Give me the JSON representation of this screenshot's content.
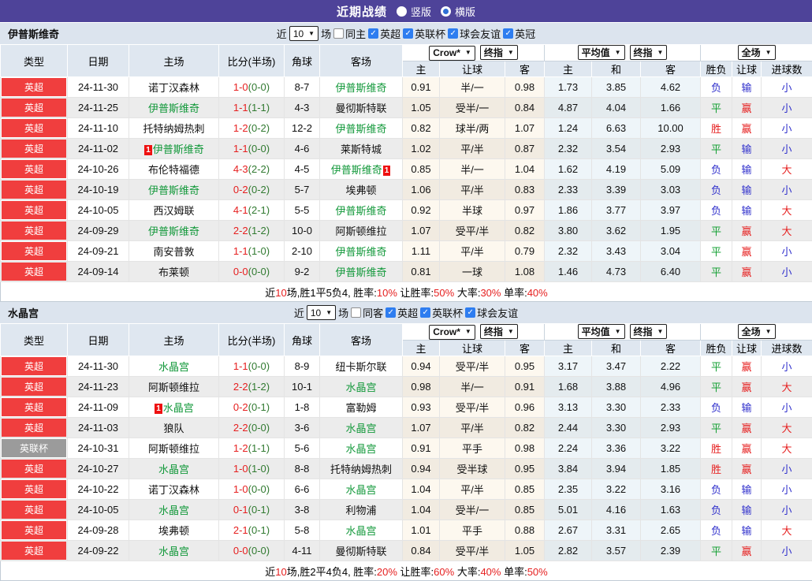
{
  "header": {
    "title": "近期战绩",
    "vertical_label": "竖版",
    "vertical_checked": false,
    "horizontal_label": "横版",
    "horizontal_checked": true
  },
  "table_header": {
    "main": [
      "类型",
      "日期",
      "主场",
      "比分(半场)",
      "角球",
      "客场"
    ],
    "sub": [
      "主",
      "让球",
      "客",
      "主",
      "和",
      "客",
      "胜负",
      "让球",
      "进球数"
    ],
    "selects": {
      "odds_source": "Crow*",
      "odds_final": "终指",
      "avg_source": "平均值",
      "avg_final": "终指",
      "full_match": "全场"
    }
  },
  "colors": {
    "topbar_bg": "#4e4399",
    "section_header_bg": "#dce4ee",
    "table_header_bg": "#dfe7f0",
    "badge_red": "#f03e3e",
    "badge_gray": "#9b9b9b",
    "team_green": "#12983a",
    "score_red": "#e62020",
    "half_score_green": "#317a31",
    "win_red": "#e62020",
    "draw_green": "#16a034",
    "lose_blue": "#3030cc",
    "checkbox_blue": "#2e7df0",
    "radio_blue": "#2f6fd6",
    "card_red": "#ee1111",
    "crow_tint": "#fdf8ef",
    "crow_tint_dark": "#f1ebe1",
    "avg_tint": "#eef5f9",
    "avg_tint_dark": "#e4ebee",
    "stripe_gray": "#ececec",
    "summary_red": "#e62020"
  },
  "sections": [
    {
      "team": "伊普斯维奇",
      "filters": {
        "near_label": "近",
        "count": "10",
        "matches_label": "场",
        "same_side_label": "同主",
        "same_side_checked": false,
        "leagues": [
          "英超",
          "英联杯",
          "球会友谊",
          "英冠"
        ]
      },
      "rows": [
        {
          "type": "英超",
          "type_color": "#f03e3e",
          "date": "24-11-30",
          "home": "诺丁汉森林",
          "home_focus": false,
          "home_card": "",
          "score": "1-0",
          "half": "(0-0)",
          "corner": "8-7",
          "away": "伊普斯维奇",
          "away_focus": true,
          "away_card": "",
          "crow": [
            "0.91",
            "半/一",
            "0.98"
          ],
          "avg": [
            "1.73",
            "3.85",
            "4.62"
          ],
          "result": [
            "负",
            "输",
            "小"
          ]
        },
        {
          "type": "英超",
          "type_color": "#f03e3e",
          "date": "24-11-25",
          "home": "伊普斯维奇",
          "home_focus": true,
          "home_card": "",
          "score": "1-1",
          "half": "(1-1)",
          "corner": "4-3",
          "away": "曼彻斯特联",
          "away_focus": false,
          "away_card": "",
          "crow": [
            "1.05",
            "受半/一",
            "0.84"
          ],
          "avg": [
            "4.87",
            "4.04",
            "1.66"
          ],
          "result": [
            "平",
            "赢",
            "小"
          ]
        },
        {
          "type": "英超",
          "type_color": "#f03e3e",
          "date": "24-11-10",
          "home": "托特纳姆热刺",
          "home_focus": false,
          "home_card": "",
          "score": "1-2",
          "half": "(0-2)",
          "corner": "12-2",
          "away": "伊普斯维奇",
          "away_focus": true,
          "away_card": "",
          "crow": [
            "0.82",
            "球半/两",
            "1.07"
          ],
          "avg": [
            "1.24",
            "6.63",
            "10.00"
          ],
          "result": [
            "胜",
            "赢",
            "小"
          ]
        },
        {
          "type": "英超",
          "type_color": "#f03e3e",
          "date": "24-11-02",
          "home": "伊普斯维奇",
          "home_focus": true,
          "home_card": "1",
          "score": "1-1",
          "half": "(0-0)",
          "corner": "4-6",
          "away": "莱斯特城",
          "away_focus": false,
          "away_card": "",
          "crow": [
            "1.02",
            "平/半",
            "0.87"
          ],
          "avg": [
            "2.32",
            "3.54",
            "2.93"
          ],
          "result": [
            "平",
            "输",
            "小"
          ]
        },
        {
          "type": "英超",
          "type_color": "#f03e3e",
          "date": "24-10-26",
          "home": "布伦特福德",
          "home_focus": false,
          "home_card": "",
          "score": "4-3",
          "half": "(2-2)",
          "corner": "4-5",
          "away": "伊普斯维奇",
          "away_focus": true,
          "away_card": "1",
          "crow": [
            "0.85",
            "半/一",
            "1.04"
          ],
          "avg": [
            "1.62",
            "4.19",
            "5.09"
          ],
          "result": [
            "负",
            "输",
            "大"
          ]
        },
        {
          "type": "英超",
          "type_color": "#f03e3e",
          "date": "24-10-19",
          "home": "伊普斯维奇",
          "home_focus": true,
          "home_card": "",
          "score": "0-2",
          "half": "(0-2)",
          "corner": "5-7",
          "away": "埃弗顿",
          "away_focus": false,
          "away_card": "",
          "crow": [
            "1.06",
            "平/半",
            "0.83"
          ],
          "avg": [
            "2.33",
            "3.39",
            "3.03"
          ],
          "result": [
            "负",
            "输",
            "小"
          ]
        },
        {
          "type": "英超",
          "type_color": "#f03e3e",
          "date": "24-10-05",
          "home": "西汉姆联",
          "home_focus": false,
          "home_card": "",
          "score": "4-1",
          "half": "(2-1)",
          "corner": "5-5",
          "away": "伊普斯维奇",
          "away_focus": true,
          "away_card": "",
          "crow": [
            "0.92",
            "半球",
            "0.97"
          ],
          "avg": [
            "1.86",
            "3.77",
            "3.97"
          ],
          "result": [
            "负",
            "输",
            "大"
          ]
        },
        {
          "type": "英超",
          "type_color": "#f03e3e",
          "date": "24-09-29",
          "home": "伊普斯维奇",
          "home_focus": true,
          "home_card": "",
          "score": "2-2",
          "half": "(1-2)",
          "corner": "10-0",
          "away": "阿斯顿维拉",
          "away_focus": false,
          "away_card": "",
          "crow": [
            "1.07",
            "受平/半",
            "0.82"
          ],
          "avg": [
            "3.80",
            "3.62",
            "1.95"
          ],
          "result": [
            "平",
            "赢",
            "大"
          ]
        },
        {
          "type": "英超",
          "type_color": "#f03e3e",
          "date": "24-09-21",
          "home": "南安普敦",
          "home_focus": false,
          "home_card": "",
          "score": "1-1",
          "half": "(1-0)",
          "corner": "2-10",
          "away": "伊普斯维奇",
          "away_focus": true,
          "away_card": "",
          "crow": [
            "1.11",
            "平/半",
            "0.79"
          ],
          "avg": [
            "2.32",
            "3.43",
            "3.04"
          ],
          "result": [
            "平",
            "赢",
            "小"
          ]
        },
        {
          "type": "英超",
          "type_color": "#f03e3e",
          "date": "24-09-14",
          "home": "布莱顿",
          "home_focus": false,
          "home_card": "",
          "score": "0-0",
          "half": "(0-0)",
          "corner": "9-2",
          "away": "伊普斯维奇",
          "away_focus": true,
          "away_card": "",
          "crow": [
            "0.81",
            "一球",
            "1.08"
          ],
          "avg": [
            "1.46",
            "4.73",
            "6.40"
          ],
          "result": [
            "平",
            "赢",
            "小"
          ]
        }
      ],
      "summary": [
        {
          "t": "近"
        },
        {
          "t": "10",
          "red": true
        },
        {
          "t": "场,胜1平5负4, 胜率:"
        },
        {
          "t": "10%",
          "red": true
        },
        {
          "t": " 让胜率:"
        },
        {
          "t": "50%",
          "red": true
        },
        {
          "t": " 大率:"
        },
        {
          "t": "30%",
          "red": true
        },
        {
          "t": " 单率:"
        },
        {
          "t": "40%",
          "red": true
        }
      ]
    },
    {
      "team": "水晶宫",
      "filters": {
        "near_label": "近",
        "count": "10",
        "matches_label": "场",
        "same_side_label": "同客",
        "same_side_checked": false,
        "leagues": [
          "英超",
          "英联杯",
          "球会友谊"
        ]
      },
      "rows": [
        {
          "type": "英超",
          "type_color": "#f03e3e",
          "date": "24-11-30",
          "home": "水晶宫",
          "home_focus": true,
          "home_card": "",
          "score": "1-1",
          "half": "(0-0)",
          "corner": "8-9",
          "away": "纽卡斯尔联",
          "away_focus": false,
          "away_card": "",
          "crow": [
            "0.94",
            "受平/半",
            "0.95"
          ],
          "avg": [
            "3.17",
            "3.47",
            "2.22"
          ],
          "result": [
            "平",
            "赢",
            "小"
          ]
        },
        {
          "type": "英超",
          "type_color": "#f03e3e",
          "date": "24-11-23",
          "home": "阿斯顿维拉",
          "home_focus": false,
          "home_card": "",
          "score": "2-2",
          "half": "(1-2)",
          "corner": "10-1",
          "away": "水晶宫",
          "away_focus": true,
          "away_card": "",
          "crow": [
            "0.98",
            "半/一",
            "0.91"
          ],
          "avg": [
            "1.68",
            "3.88",
            "4.96"
          ],
          "result": [
            "平",
            "赢",
            "大"
          ]
        },
        {
          "type": "英超",
          "type_color": "#f03e3e",
          "date": "24-11-09",
          "home": "水晶宫",
          "home_focus": true,
          "home_card": "1",
          "score": "0-2",
          "half": "(0-1)",
          "corner": "1-8",
          "away": "富勒姆",
          "away_focus": false,
          "away_card": "",
          "crow": [
            "0.93",
            "受平/半",
            "0.96"
          ],
          "avg": [
            "3.13",
            "3.30",
            "2.33"
          ],
          "result": [
            "负",
            "输",
            "小"
          ]
        },
        {
          "type": "英超",
          "type_color": "#f03e3e",
          "date": "24-11-03",
          "home": "狼队",
          "home_focus": false,
          "home_card": "",
          "score": "2-2",
          "half": "(0-0)",
          "corner": "3-6",
          "away": "水晶宫",
          "away_focus": true,
          "away_card": "",
          "crow": [
            "1.07",
            "平/半",
            "0.82"
          ],
          "avg": [
            "2.44",
            "3.30",
            "2.93"
          ],
          "result": [
            "平",
            "赢",
            "大"
          ]
        },
        {
          "type": "英联杯",
          "type_color": "#9b9b9b",
          "date": "24-10-31",
          "home": "阿斯顿维拉",
          "home_focus": false,
          "home_card": "",
          "score": "1-2",
          "half": "(1-1)",
          "corner": "5-6",
          "away": "水晶宫",
          "away_focus": true,
          "away_card": "",
          "crow": [
            "0.91",
            "平手",
            "0.98"
          ],
          "avg": [
            "2.24",
            "3.36",
            "3.22"
          ],
          "result": [
            "胜",
            "赢",
            "大"
          ]
        },
        {
          "type": "英超",
          "type_color": "#f03e3e",
          "date": "24-10-27",
          "home": "水晶宫",
          "home_focus": true,
          "home_card": "",
          "score": "1-0",
          "half": "(1-0)",
          "corner": "8-8",
          "away": "托特纳姆热刺",
          "away_focus": false,
          "away_card": "",
          "crow": [
            "0.94",
            "受半球",
            "0.95"
          ],
          "avg": [
            "3.84",
            "3.94",
            "1.85"
          ],
          "result": [
            "胜",
            "赢",
            "小"
          ]
        },
        {
          "type": "英超",
          "type_color": "#f03e3e",
          "date": "24-10-22",
          "home": "诺丁汉森林",
          "home_focus": false,
          "home_card": "",
          "score": "1-0",
          "half": "(0-0)",
          "corner": "6-6",
          "away": "水晶宫",
          "away_focus": true,
          "away_card": "",
          "crow": [
            "1.04",
            "平/半",
            "0.85"
          ],
          "avg": [
            "2.35",
            "3.22",
            "3.16"
          ],
          "result": [
            "负",
            "输",
            "小"
          ]
        },
        {
          "type": "英超",
          "type_color": "#f03e3e",
          "date": "24-10-05",
          "home": "水晶宫",
          "home_focus": true,
          "home_card": "",
          "score": "0-1",
          "half": "(0-1)",
          "corner": "3-8",
          "away": "利物浦",
          "away_focus": false,
          "away_card": "",
          "crow": [
            "1.04",
            "受半/一",
            "0.85"
          ],
          "avg": [
            "5.01",
            "4.16",
            "1.63"
          ],
          "result": [
            "负",
            "输",
            "小"
          ]
        },
        {
          "type": "英超",
          "type_color": "#f03e3e",
          "date": "24-09-28",
          "home": "埃弗顿",
          "home_focus": false,
          "home_card": "",
          "score": "2-1",
          "half": "(0-1)",
          "corner": "5-8",
          "away": "水晶宫",
          "away_focus": true,
          "away_card": "",
          "crow": [
            "1.01",
            "平手",
            "0.88"
          ],
          "avg": [
            "2.67",
            "3.31",
            "2.65"
          ],
          "result": [
            "负",
            "输",
            "大"
          ]
        },
        {
          "type": "英超",
          "type_color": "#f03e3e",
          "date": "24-09-22",
          "home": "水晶宫",
          "home_focus": true,
          "home_card": "",
          "score": "0-0",
          "half": "(0-0)",
          "corner": "4-11",
          "away": "曼彻斯特联",
          "away_focus": false,
          "away_card": "",
          "crow": [
            "0.84",
            "受平/半",
            "1.05"
          ],
          "avg": [
            "2.82",
            "3.57",
            "2.39"
          ],
          "result": [
            "平",
            "赢",
            "小"
          ]
        }
      ],
      "summary": [
        {
          "t": "近"
        },
        {
          "t": "10",
          "red": true
        },
        {
          "t": "场,胜2平4负4, 胜率:"
        },
        {
          "t": "20%",
          "red": true
        },
        {
          "t": " 让胜率:"
        },
        {
          "t": "60%",
          "red": true
        },
        {
          "t": " 大率:"
        },
        {
          "t": "40%",
          "red": true
        },
        {
          "t": " 单率:"
        },
        {
          "t": "50%",
          "red": true
        }
      ]
    }
  ]
}
